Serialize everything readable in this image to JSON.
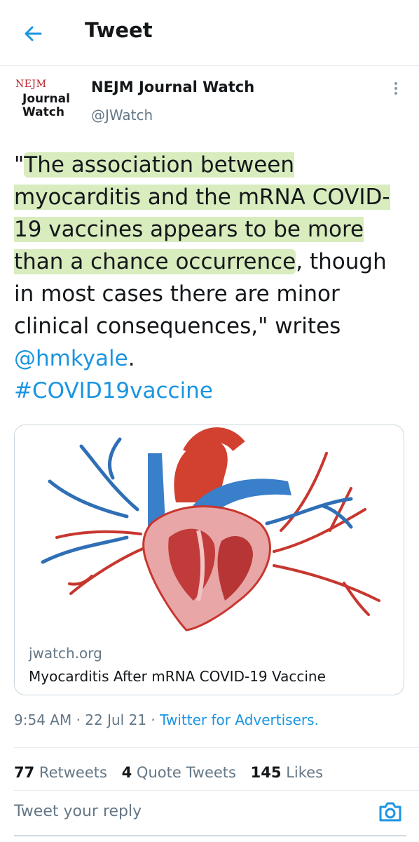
{
  "header": {
    "title": "Tweet",
    "back_icon": "arrow-left-icon"
  },
  "author": {
    "logo_line1": "NEJM",
    "logo_line2": "Journal",
    "logo_line3": "Watch",
    "name": "NEJM Journal Watch",
    "handle": "@JWatch"
  },
  "tweet": {
    "text_hl1": "The association between myocarditis and the mRNA COVID-19 vaccines appears to be more than a chance occurrence",
    "quote_open": "\"",
    "text_rest": ", though in most cases there are minor clinical consequences,\" writes ",
    "mention": "@hmkyale",
    "period": ".",
    "hashtag": "#COVID19vaccine"
  },
  "card": {
    "domain": "jwatch.org",
    "title": "Myocarditis After mRNA COVID-19 Vaccine",
    "image": "heart-illustration"
  },
  "meta": {
    "time": "9:54 AM",
    "sep": "·",
    "date": "22 Jul 21",
    "source": "Twitter for Advertisers."
  },
  "stats": {
    "retweets_count": "77",
    "retweets_label": "Retweets",
    "quotes_count": "4",
    "quotes_label": "Quote Tweets",
    "likes_count": "145",
    "likes_label": "Likes"
  },
  "reply": {
    "placeholder": "Tweet your reply",
    "camera_icon": "camera-icon"
  },
  "colors": {
    "link": "#1b95e0",
    "highlight": "#a8d46e",
    "logo_red": "#b2262c"
  }
}
